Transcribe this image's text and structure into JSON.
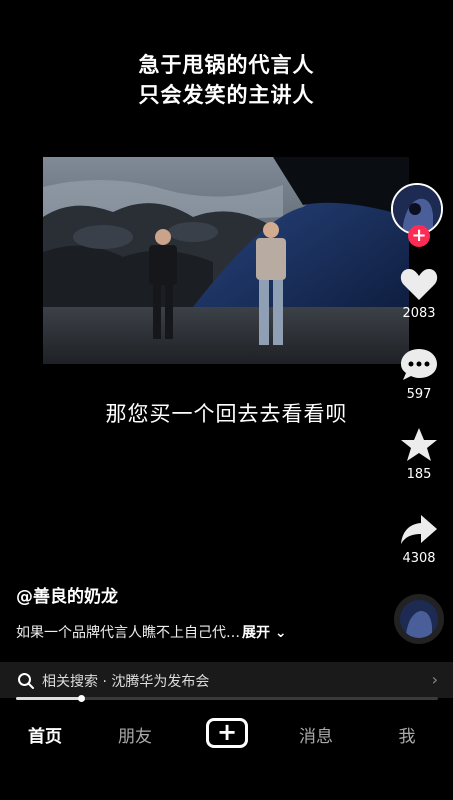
{
  "overlay_caption": {
    "line1": "急于甩锅的代言人",
    "line2": "只会发笑的主讲人"
  },
  "subtitle": "那您买一个回去去看看呗",
  "rail": {
    "follow_symbol": "+",
    "likes": "2083",
    "comments": "597",
    "favorites": "185",
    "shares": "4308",
    "icons": [
      "heart-icon",
      "comment-icon",
      "star-icon",
      "share-icon"
    ]
  },
  "author": "@善良的奶龙",
  "description": "如果一个品牌代言人瞧不上自己代…",
  "expand_label": "展开",
  "related_search": {
    "label": "相关搜索 · 沈腾华为发布会"
  },
  "playback_progress": 0.155,
  "tabs": {
    "home": "首页",
    "friends": "朋友",
    "add": "+",
    "messages": "消息",
    "me": "我"
  },
  "colors": {
    "accent": "#fe2c55",
    "background": "#000000"
  }
}
